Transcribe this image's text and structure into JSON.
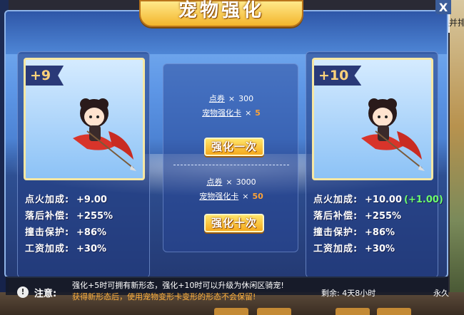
{
  "window": {
    "title": "宠物强化",
    "close_label": "X"
  },
  "filter": {
    "label": "只看期限并排"
  },
  "current": {
    "level": "+9",
    "stats": [
      {
        "label": "点火加成:",
        "value": "+9.00",
        "bonus": ""
      },
      {
        "label": "落后补偿:",
        "value": "+255%",
        "bonus": ""
      },
      {
        "label": "撞击保护:",
        "value": "+86%",
        "bonus": ""
      },
      {
        "label": "工资加成:",
        "value": "+30%",
        "bonus": ""
      }
    ]
  },
  "next": {
    "level": "+10",
    "stats": [
      {
        "label": "点火加成:",
        "value": "+10.00",
        "bonus": "(+1.00)"
      },
      {
        "label": "落后补偿:",
        "value": "+255%",
        "bonus": ""
      },
      {
        "label": "撞击保护:",
        "value": "+86%",
        "bonus": ""
      },
      {
        "label": "工资加成:",
        "value": "+30%",
        "bonus": ""
      }
    ]
  },
  "once": {
    "coupon_name": "点券",
    "coupon_amount": "300",
    "card_name": "宠物强化卡",
    "card_amount": "5",
    "button_label": "强化一次"
  },
  "ten": {
    "coupon_name": "点券",
    "coupon_amount": "3000",
    "card_name": "宠物强化卡",
    "card_amount": "50",
    "button_label": "强化十次"
  },
  "multiply_sign": "×",
  "notice": {
    "label": "注意:",
    "line1": "强化+5时可拥有新形态，强化+10时可以升级为休闲区骑宠!",
    "line2": "获得新形态后，使用宠物变形卡变形的形态不会保留!",
    "remain": "剩余: 4天8小时",
    "perm": "永久"
  },
  "colors": {
    "accent_gold": "#f5a91c",
    "bonus_green": "#6dff6d",
    "warning_orange": "#ffb23f"
  }
}
